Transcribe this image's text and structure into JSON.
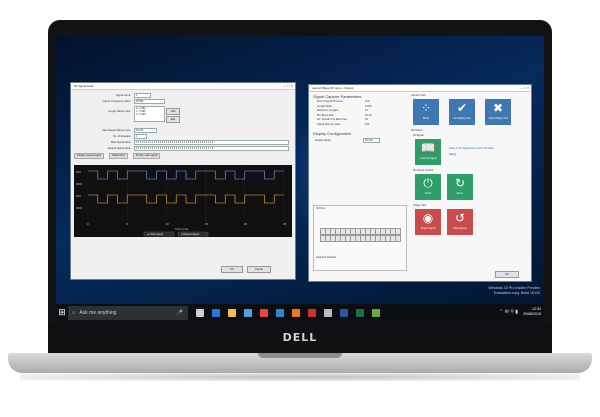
{
  "desktop": {
    "watermark": [
      "Windows 10 Pro Insider Preview",
      "Evaluation copy. Build 10130"
    ],
    "clock": {
      "time": "12:34",
      "date": "29/06/2015"
    }
  },
  "brand": {
    "logo_text": "DELL"
  },
  "taskbar": {
    "search_placeholder": "Ask me anything",
    "icons": [
      "task-view-icon",
      "edge-icon",
      "explorer-icon",
      "store-icon",
      "chrome-icon",
      "mail-icon",
      "firefox-icon",
      "paint-icon",
      "notepad-icon",
      "word-icon",
      "excel-icon",
      "app-icon"
    ]
  },
  "signal_window": {
    "title": "IR Signal Data",
    "fields": [
      {
        "label": "Signal name:",
        "value": "2"
      },
      {
        "label": "Carrier Frequency (kHz):",
        "value": "35.556"
      },
      {
        "label": "Length Values (ms):",
        "value": "0 - 2.362\n1 - 0.395\n2 - 0.425"
      },
      {
        "label": "Max Repeat Pause (ms):",
        "value": "110.50"
      },
      {
        "label": "No. of Repeats:",
        "value": "1"
      },
      {
        "label": "Raw Signal Data:",
        "value": "0 1 2 2 2 2 2 2 1 2 1 2 2 2 2 2 2 2 2 2 2 2 1 2 2 1 2 2 2 2 2 2 2 2 2 2 1 1 2"
      },
      {
        "label": "Repeat Signal Data:",
        "value": "0 1 2 2 2 2 2 2 1 2 1 2 2 2 2 2 2 2 2 2 2 2 1 2 2 1 2 2 2 2 2 2 2 2 2 2 1 1 2"
      }
    ],
    "buttons": {
      "add": "Add",
      "edit": "Edit",
      "ok": "OK",
      "cancel": "Cancel"
    },
    "tabs": [
      "Display repeat signal",
      "Stationarity",
      "Do the main signal"
    ],
    "chart_data": {
      "type": "line",
      "series": [
        {
          "name": "Initial signal",
          "values": [
            1,
            0,
            1,
            0,
            1,
            1,
            0,
            1,
            0,
            1,
            0,
            1,
            1,
            0,
            1,
            0,
            1,
            1,
            0,
            1
          ]
        },
        {
          "name": "Repeat signal",
          "values": [
            1,
            0,
            1,
            0,
            1,
            1,
            0,
            1,
            0,
            1,
            0,
            1,
            1,
            0,
            1,
            0,
            1,
            1,
            0,
            1
          ]
        }
      ],
      "x": [
        0,
        5,
        10,
        15,
        20,
        25
      ],
      "y_ticks": [
        "ON",
        "OFF",
        "ON",
        "OFF"
      ],
      "xlabel": "Time (ms)",
      "ylabel": "",
      "legend": [
        "Initial signal",
        "Repeat signal"
      ],
      "grid": true
    }
  },
  "config_window": {
    "title": "Launch Base IR Input + Output",
    "sections": {
      "capture": "Signal Capture Parameters",
      "display": "Display Configuration",
      "ir_ports": "IR Ports",
      "selected": "Selected Outputs"
    },
    "capture_params": [
      {
        "label": "End of Signal Timeout",
        "value": "100"
      },
      {
        "label": "Length Delta",
        "value": "0.050"
      },
      {
        "label": "Maximum Lengths",
        "value": "16"
      },
      {
        "label": "Min Burst Size",
        "value": "16.10"
      },
      {
        "label": "No. Periods For Max Freq",
        "value": "32"
      },
      {
        "label": "Signal Memory Size",
        "value": "512"
      }
    ],
    "display_mode": {
      "label": "Display Mode",
      "value": "Normal"
    },
    "generic_title": "Generic Tool",
    "generic_buttons": [
      "Block",
      "Set Display Tool",
      "Clear Display Tool"
    ],
    "ir_output": "IR Output",
    "ir_signal": "IR Signal",
    "learn_label": "Learn IR Signal",
    "drag_hint": "Drag an IR Signal here (Input 3/8 utility",
    "drag_sub": "String",
    "output_control": "IR Output Control",
    "output_control_buttons": [
      "All On",
      "Demo"
    ],
    "output_test": "Output Test",
    "output_test_buttons": [
      "Output Signal",
      "Start Repeat"
    ],
    "ok": "OK"
  }
}
